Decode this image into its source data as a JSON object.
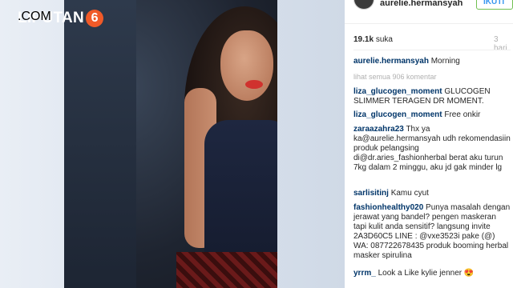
{
  "brand": {
    "name": "LIPUTAN",
    "badge": "6",
    "domain": ".COM"
  },
  "post": {
    "username": "aurelie.hermansyah",
    "follow_label": "IKUTI",
    "likes": "19.1k",
    "likes_suffix": "suka",
    "time_ago": "3 hari",
    "caption_user": "aurelie.hermansyah",
    "caption_text": "Morning",
    "view_all": "lihat semua 906 komentar"
  },
  "comments": [
    {
      "user": "liza_glucogen_moment",
      "text": "GLUCOGEN SLIMMER TERAGEN DR MOMENT."
    },
    {
      "user": "liza_glucogen_moment",
      "text": "Free onkir"
    },
    {
      "user": "zaraazahra23",
      "text": "Thx ya ka@aurelie.hermansyah udh rekomendasiin produk pelangsing di@dr.aries_fashionherbal berat aku turun 7kg dalam 2 minggu, aku jd gak minder lg"
    },
    {
      "user": "sarlisitinj",
      "text": "Kamu cyut"
    },
    {
      "user": "fashionhealthy020",
      "text": "Punya masalah dengan jerawat yang bandel? pengen maskeran tapi kulit anda sensitif? langsung invite 2A3D60C5 LINE : @vxe3523i pake (@) WA: 087722678435 produk booming herbal masker spirulina"
    },
    {
      "user": "yrrm_",
      "text": "Look a Like kylie jenner 😍"
    }
  ],
  "colors": {
    "brand_orange": "#f05a28",
    "username_blue": "#003569",
    "follow_border": "#70c050"
  },
  "icons": {
    "avatar": "profile-avatar"
  }
}
